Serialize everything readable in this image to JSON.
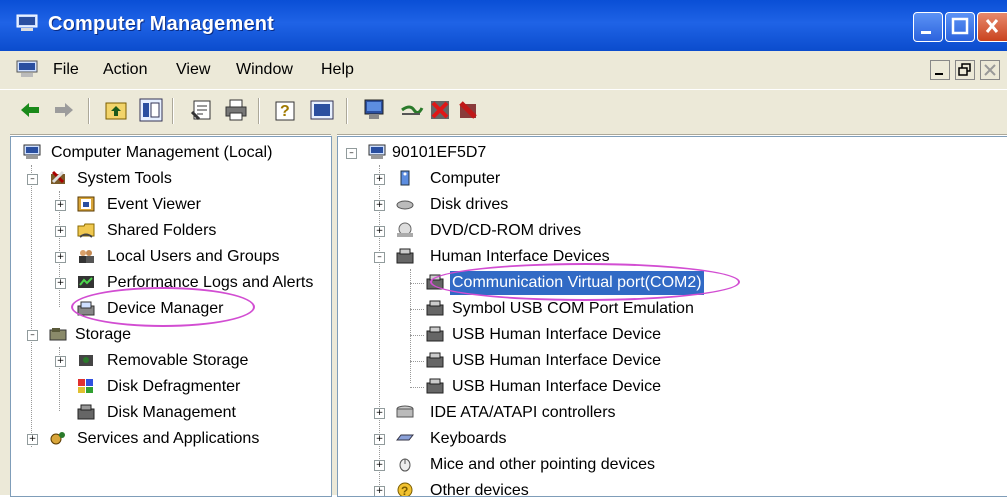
{
  "window": {
    "title": "Computer Management"
  },
  "menu": [
    "File",
    "Action",
    "View",
    "Window",
    "Help"
  ],
  "left_tree": {
    "root": "Computer Management (Local)",
    "system_tools": "System Tools",
    "event_viewer": "Event Viewer",
    "shared_folders": "Shared Folders",
    "local_users": "Local Users and Groups",
    "perf_logs": "Performance Logs and Alerts",
    "device_manager": "Device Manager",
    "storage": "Storage",
    "removable_storage": "Removable Storage",
    "disk_defrag": "Disk Defragmenter",
    "disk_mgmt": "Disk Management",
    "services_apps": "Services and Applications"
  },
  "right_tree": {
    "root": "90101EF5D7",
    "computer": "Computer",
    "disk_drives": "Disk drives",
    "dvd": "DVD/CD-ROM drives",
    "hid": "Human Interface Devices",
    "com2": "Communication Virtual port(COM2)",
    "symbol_usb": "Symbol USB COM Port Emulation",
    "usb_hid_1": "USB Human Interface Device",
    "usb_hid_2": "USB Human Interface Device",
    "usb_hid_3": "USB Human Interface Device",
    "ide": "IDE ATA/ATAPI controllers",
    "keyboards": "Keyboards",
    "mice": "Mice and other pointing devices",
    "other": "Other devices"
  },
  "colors": {
    "title_bar": "#1f63e6",
    "selection": "#316ac5",
    "highlight_ellipse": "#d24dd2"
  }
}
